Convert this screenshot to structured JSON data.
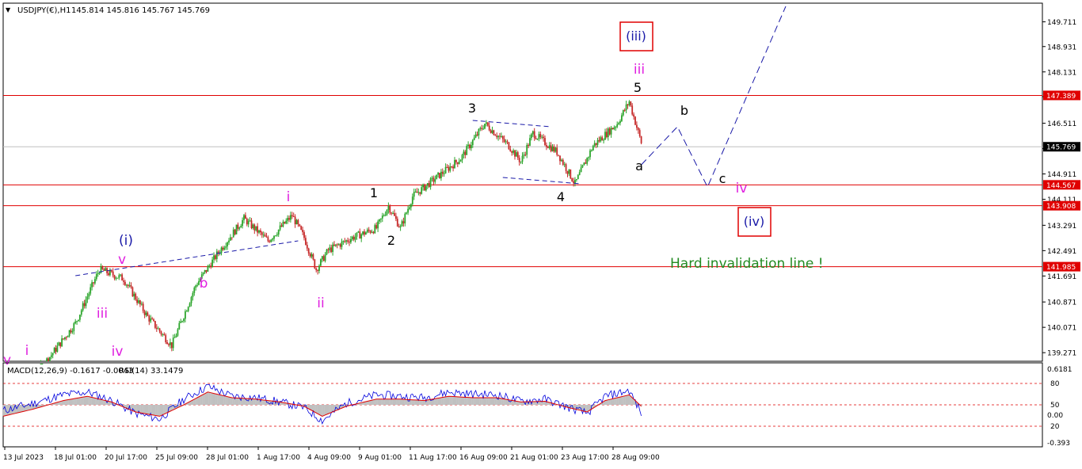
{
  "header": {
    "symbol_text": "USDJPY(€),H1",
    "ohlc_text": "145.814 145.816 145.767 145.769"
  },
  "indicator_header": {
    "macd_text": "MACD(12,26,9) -0.1617 -0.0043",
    "rsi_text": "RSI(14) 33.1479"
  },
  "colors": {
    "bull": "#2ca52c",
    "bear": "#c62a2a",
    "level_line": "#e00000",
    "wave_blue": "#1a1aa8",
    "wave_magenta": "#e020e0",
    "invalidation_green": "#228b22",
    "macd_hist": "#c0c0c0",
    "macd_signal": "#e00000",
    "rsi_line": "#0000dd"
  },
  "chart_data": [
    {
      "type": "candlestick",
      "title": "USDJPY(€),H1",
      "ohlc_last": {
        "open": 145.814,
        "high": 145.816,
        "low": 145.767,
        "close": 145.769
      },
      "ylim": [
        139.0,
        150.3
      ],
      "price_ticks": [
        "149.711",
        "148.931",
        "148.131",
        "147.351",
        "146.511",
        "145.711",
        "144.911",
        "144.111",
        "143.291",
        "142.491",
        "141.691",
        "140.871",
        "140.071",
        "139.271"
      ],
      "time_ticks": [
        "13 Jul 2023",
        "18 Jul 01:00",
        "20 Jul 17:00",
        "25 Jul 09:00",
        "28 Jul 01:00",
        "1 Aug 17:00",
        "4 Aug 09:00",
        "9 Aug 01:00",
        "11 Aug 17:00",
        "16 Aug 09:00",
        "21 Aug 01:00",
        "23 Aug 17:00",
        "28 Aug 09:00"
      ],
      "price_path": [
        [
          0,
          137.8
        ],
        [
          4,
          138.3
        ],
        [
          8,
          139.2
        ],
        [
          12,
          140.2
        ],
        [
          16,
          141.9
        ],
        [
          20,
          141.6
        ],
        [
          24,
          140.4
        ],
        [
          28,
          139.5
        ],
        [
          32,
          141.4
        ],
        [
          36,
          142.5
        ],
        [
          40,
          143.5
        ],
        [
          44,
          142.8
        ],
        [
          48,
          143.6
        ],
        [
          50,
          142.9
        ],
        [
          52,
          141.9
        ],
        [
          54,
          142.5
        ],
        [
          58,
          142.9
        ],
        [
          62,
          143.2
        ],
        [
          64,
          143.9
        ],
        [
          66,
          143.2
        ],
        [
          68,
          144.2
        ],
        [
          72,
          144.8
        ],
        [
          76,
          145.4
        ],
        [
          80,
          146.5
        ],
        [
          84,
          145.8
        ],
        [
          86,
          145.3
        ],
        [
          88,
          146.2
        ],
        [
          92,
          145.6
        ],
        [
          95,
          144.6
        ],
        [
          98,
          145.8
        ],
        [
          102,
          146.5
        ],
        [
          104,
          147.2
        ],
        [
          106,
          145.9
        ]
      ],
      "levels": [
        {
          "value": 147.389,
          "label": "147.389"
        },
        {
          "value": 144.567,
          "label": "144.567"
        },
        {
          "value": 143.908,
          "label": "143.908"
        },
        {
          "value": 141.985,
          "label": "141.985"
        }
      ],
      "current": {
        "value": 145.769,
        "label": "145.769"
      },
      "projection": [
        [
          106,
          145.2
        ],
        [
          112,
          146.4
        ],
        [
          117,
          144.5
        ],
        [
          130,
          150.2
        ]
      ],
      "wave_labels": [
        {
          "text": "(iii)",
          "color": "blue",
          "boxed": true
        },
        {
          "text": "iii",
          "color": "magenta"
        },
        {
          "text": "5",
          "color": "black"
        },
        {
          "text": "3",
          "color": "black"
        },
        {
          "text": "b",
          "color": "black"
        },
        {
          "text": "a",
          "color": "black"
        },
        {
          "text": "c",
          "color": "black"
        },
        {
          "text": "iv",
          "color": "magenta"
        },
        {
          "text": "(iv)",
          "color": "blue",
          "boxed": true
        },
        {
          "text": "1",
          "color": "black"
        },
        {
          "text": "2",
          "color": "black"
        },
        {
          "text": "4",
          "color": "black"
        },
        {
          "text": "i",
          "color": "magenta"
        },
        {
          "text": "ii",
          "color": "magenta"
        },
        {
          "text": "(i)",
          "color": "blue"
        },
        {
          "text": "v",
          "color": "magenta"
        },
        {
          "text": "iii",
          "color": "magenta"
        },
        {
          "text": "iv",
          "color": "magenta"
        },
        {
          "text": "b",
          "color": "magenta"
        },
        {
          "text": "i",
          "color": "magenta"
        },
        {
          "text": "v",
          "color": "magenta"
        }
      ],
      "annotation": "Hard invalidation line !"
    },
    {
      "type": "line",
      "title": "MACD(12,26,9) -0.1617 -0.0043 RSI(14) 33.1479",
      "macd_ticks": [
        "0.6181",
        "0.00",
        "-0.393"
      ],
      "rsi_ticks": [
        "80",
        "50",
        "20"
      ],
      "rsi_levels": [
        80,
        50,
        20
      ],
      "rsi_path": [
        [
          0,
          42
        ],
        [
          5,
          52
        ],
        [
          10,
          64
        ],
        [
          14,
          68
        ],
        [
          18,
          56
        ],
        [
          22,
          38
        ],
        [
          26,
          30
        ],
        [
          30,
          58
        ],
        [
          34,
          76
        ],
        [
          38,
          62
        ],
        [
          42,
          60
        ],
        [
          46,
          54
        ],
        [
          50,
          46
        ],
        [
          53,
          28
        ],
        [
          57,
          52
        ],
        [
          62,
          64
        ],
        [
          66,
          62
        ],
        [
          70,
          60
        ],
        [
          74,
          68
        ],
        [
          78,
          65
        ],
        [
          82,
          64
        ],
        [
          86,
          55
        ],
        [
          90,
          58
        ],
        [
          94,
          46
        ],
        [
          97,
          38
        ],
        [
          100,
          62
        ],
        [
          104,
          70
        ],
        [
          106,
          38
        ]
      ],
      "signal_path": [
        [
          0,
          34
        ],
        [
          5,
          44
        ],
        [
          10,
          56
        ],
        [
          14,
          62
        ],
        [
          18,
          54
        ],
        [
          22,
          40
        ],
        [
          26,
          34
        ],
        [
          30,
          50
        ],
        [
          34,
          68
        ],
        [
          38,
          60
        ],
        [
          42,
          58
        ],
        [
          46,
          54
        ],
        [
          50,
          48
        ],
        [
          53,
          34
        ],
        [
          57,
          48
        ],
        [
          62,
          58
        ],
        [
          66,
          58
        ],
        [
          70,
          56
        ],
        [
          74,
          62
        ],
        [
          78,
          60
        ],
        [
          82,
          60
        ],
        [
          86,
          54
        ],
        [
          90,
          55
        ],
        [
          94,
          46
        ],
        [
          97,
          40
        ],
        [
          100,
          56
        ],
        [
          104,
          64
        ],
        [
          106,
          48
        ]
      ]
    }
  ]
}
